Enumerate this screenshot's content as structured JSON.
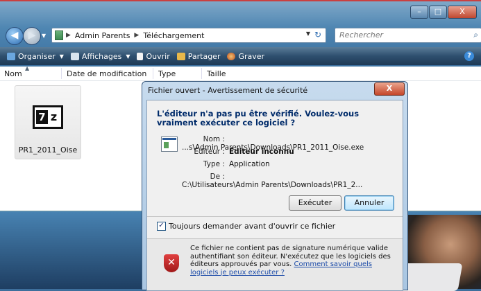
{
  "explorer": {
    "window_buttons": {
      "minimize": "–",
      "maximize": "□",
      "close": "X"
    },
    "breadcrumbs": [
      "Admin Parents",
      "Téléchargement"
    ],
    "search_placeholder": "Rechercher",
    "toolbar": {
      "organize": "Organiser",
      "views": "Affichages",
      "open": "Ouvrir",
      "share": "Partager",
      "burn": "Graver"
    },
    "columns": [
      "Nom",
      "Date de modification",
      "Type",
      "Taille"
    ],
    "file": {
      "name": "PR1_2011_Oise",
      "icon_left": "7",
      "icon_right": "z"
    }
  },
  "dialog": {
    "title": "Fichier ouvert - Avertissement de sécurité",
    "close": "X",
    "question": "L'éditeur n'a pas pu être vérifié. Voulez-vous vraiment exécuter ce logiciel ?",
    "details": {
      "name_label": "Nom :",
      "name_value": "...s\\Admin Parents\\Downloads\\PR1_2011_Oise.exe",
      "publisher_label": "Éditeur :",
      "publisher_value": "Éditeur inconnu",
      "type_label": "Type :",
      "type_value": "Application",
      "from_label": "De :",
      "from_value": "C:\\Utilisateurs\\Admin Parents\\Downloads\\PR1_2..."
    },
    "run_button": "Exécuter",
    "cancel_button": "Annuler",
    "always_ask": "Toujours demander avant d'ouvrir ce fichier",
    "always_ask_checked": true,
    "warning_text": "Ce fichier ne contient pas de signature numérique valide authentifiant son éditeur. N'exécutez que les logiciels des éditeurs approuvés par vous.",
    "warning_link": "Comment savoir quels logiciels je peux exécuter ?"
  }
}
